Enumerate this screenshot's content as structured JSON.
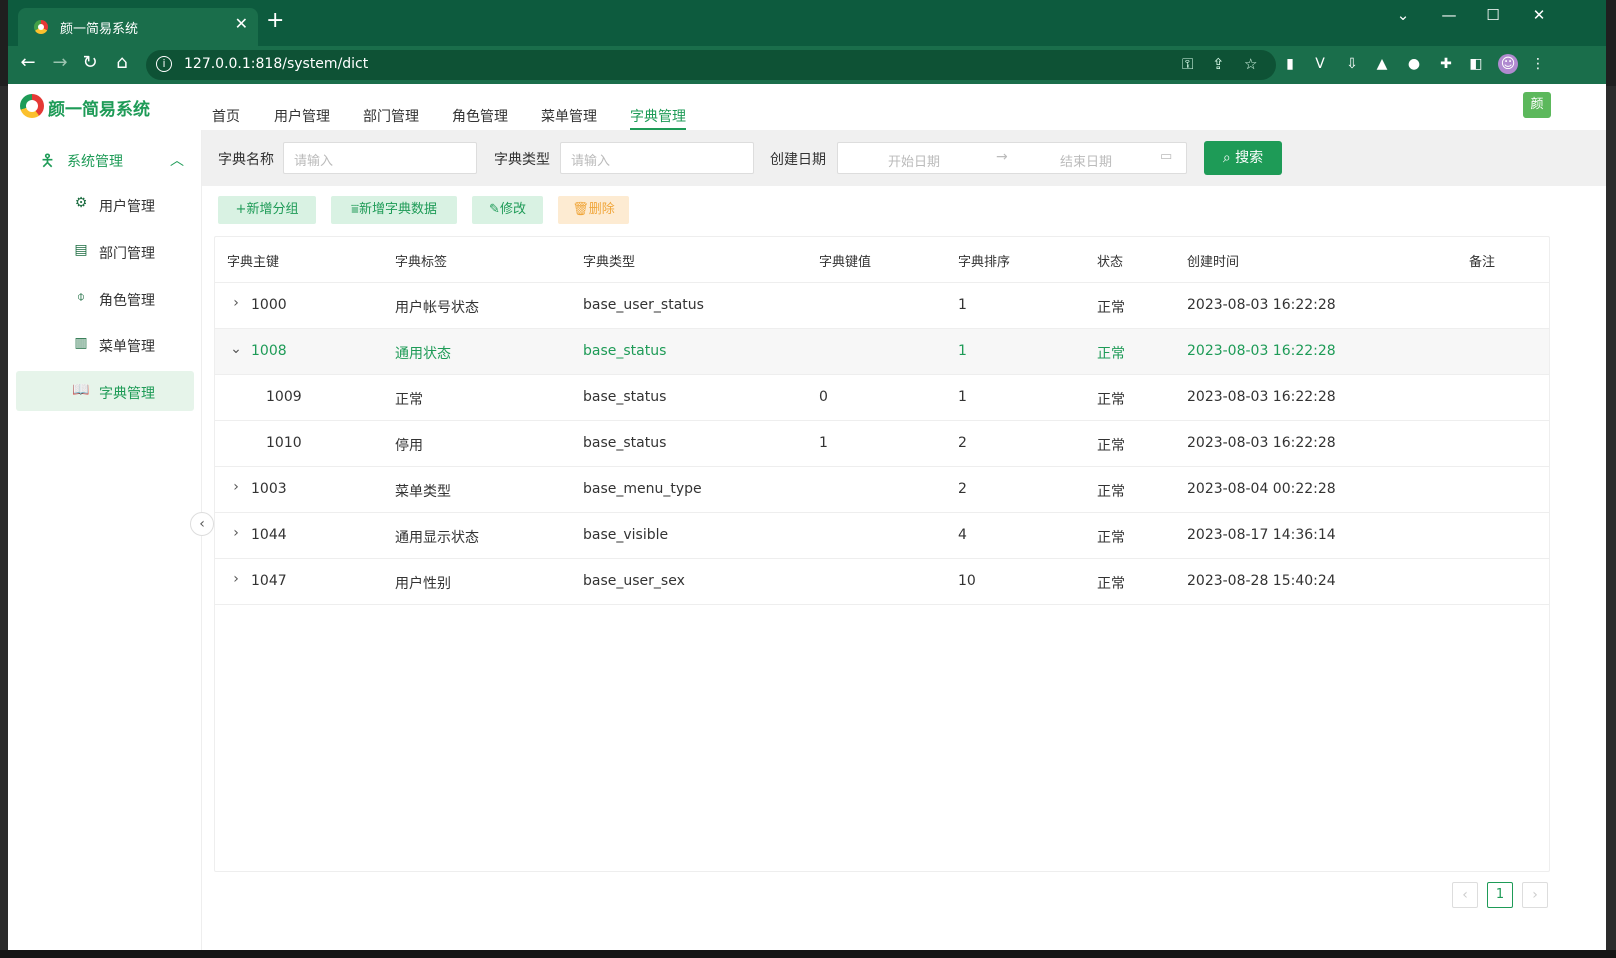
{
  "browser": {
    "tab_title": "颜一简易系统",
    "url": "127.0.0.1:818/system/dict"
  },
  "app": {
    "title": "颜一简易系统",
    "avatar_text": "颜",
    "top_nav": [
      "首页",
      "用户管理",
      "部门管理",
      "角色管理",
      "菜单管理",
      "字典管理"
    ],
    "active_top_nav": "字典管理",
    "accent_color": "#1e9b57"
  },
  "sidebar": {
    "group_label": "系统管理",
    "items": [
      {
        "label": "用户管理",
        "icon": "user-gear-icon"
      },
      {
        "label": "部门管理",
        "icon": "archive-box-icon"
      },
      {
        "label": "角色管理",
        "icon": "paperclip-icon"
      },
      {
        "label": "菜单管理",
        "icon": "bar-chart-icon"
      },
      {
        "label": "字典管理",
        "icon": "open-book-icon"
      }
    ],
    "active_item": "字典管理"
  },
  "search": {
    "name_label": "字典名称",
    "name_placeholder": "请输入",
    "type_label": "字典类型",
    "type_placeholder": "请输入",
    "date_label": "创建日期",
    "start_placeholder": "开始日期",
    "end_placeholder": "结束日期",
    "search_button": "搜索"
  },
  "actions": {
    "add_group": "新增分组",
    "add_data": "新增字典数据",
    "edit": "修改",
    "delete": "删除"
  },
  "table": {
    "headers": [
      "字典主键",
      "字典标签",
      "字典类型",
      "字典键值",
      "字典排序",
      "状态",
      "创建时间",
      "备注"
    ],
    "rows": [
      {
        "id": "1000",
        "label": "用户帐号状态",
        "type": "base_user_status",
        "value": "",
        "sort": "1",
        "status": "正常",
        "created": "2023-08-03 16:22:28",
        "remark": "",
        "expander": "collapsed"
      },
      {
        "id": "1008",
        "label": "通用状态",
        "type": "base_status",
        "value": "",
        "sort": "1",
        "status": "正常",
        "created": "2023-08-03 16:22:28",
        "remark": "",
        "expander": "expanded"
      },
      {
        "id": "1009",
        "label": "正常",
        "type": "base_status",
        "value": "0",
        "sort": "1",
        "status": "正常",
        "created": "2023-08-03 16:22:28",
        "remark": "",
        "expander": "child"
      },
      {
        "id": "1010",
        "label": "停用",
        "type": "base_status",
        "value": "1",
        "sort": "2",
        "status": "正常",
        "created": "2023-08-03 16:22:28",
        "remark": "",
        "expander": "child"
      },
      {
        "id": "1003",
        "label": "菜单类型",
        "type": "base_menu_type",
        "value": "",
        "sort": "2",
        "status": "正常",
        "created": "2023-08-04 00:22:28",
        "remark": "",
        "expander": "collapsed"
      },
      {
        "id": "1044",
        "label": "通用显示状态",
        "type": "base_visible",
        "value": "",
        "sort": "4",
        "status": "正常",
        "created": "2023-08-17 14:36:14",
        "remark": "",
        "expander": "collapsed"
      },
      {
        "id": "1047",
        "label": "用户性别",
        "type": "base_user_sex",
        "value": "",
        "sort": "10",
        "status": "正常",
        "created": "2023-08-28 15:40:24",
        "remark": "",
        "expander": "collapsed"
      }
    ]
  },
  "pagination": {
    "current_page": "1"
  }
}
